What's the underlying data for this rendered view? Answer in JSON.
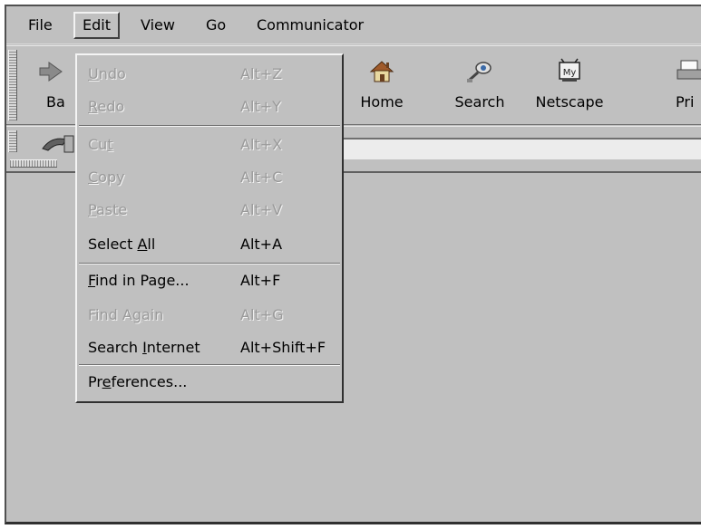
{
  "menubar": {
    "items": [
      {
        "label": "File"
      },
      {
        "label": "Edit"
      },
      {
        "label": "View"
      },
      {
        "label": "Go"
      },
      {
        "label": "Communicator"
      }
    ]
  },
  "toolbar": {
    "buttons": [
      {
        "label": "Ba",
        "icon": "back-arrow-icon"
      },
      {
        "label": "Home",
        "icon": "home-icon"
      },
      {
        "label": "Search",
        "icon": "search-icon"
      },
      {
        "label": "Netscape",
        "icon": "my-netscape-icon"
      },
      {
        "label": "Pri",
        "icon": "print-icon"
      }
    ]
  },
  "location_bar": {
    "icon": "bookmarks-icon",
    "url": ""
  },
  "edit_menu": {
    "items": [
      {
        "pre": "",
        "mn": "U",
        "post": "ndo",
        "shortcut": "Alt+Z",
        "enabled": false
      },
      {
        "pre": "",
        "mn": "R",
        "post": "edo",
        "shortcut": "Alt+Y",
        "enabled": false
      },
      {
        "pre": "Cu",
        "mn": "t",
        "post": "",
        "shortcut": "Alt+X",
        "enabled": false
      },
      {
        "pre": "",
        "mn": "C",
        "post": "opy",
        "shortcut": "Alt+C",
        "enabled": false
      },
      {
        "pre": "",
        "mn": "P",
        "post": "aste",
        "shortcut": "Alt+V",
        "enabled": false
      },
      {
        "pre": "Select ",
        "mn": "A",
        "post": "ll",
        "shortcut": "Alt+A",
        "enabled": true
      },
      {
        "pre": "",
        "mn": "F",
        "post": "ind in Page...",
        "shortcut": "Alt+F",
        "enabled": true
      },
      {
        "pre": "Find A",
        "mn": "g",
        "post": "ain",
        "shortcut": "Alt+G",
        "enabled": false
      },
      {
        "pre": "Search ",
        "mn": "I",
        "post": "nternet",
        "shortcut": "Alt+Shift+F",
        "enabled": true
      },
      {
        "pre": "Pr",
        "mn": "e",
        "post": "ferences...",
        "shortcut": "",
        "enabled": true
      }
    ]
  },
  "colors": {
    "chrome": "#c0c0c0",
    "disabled_text": "#9a9a9a",
    "highlight_edge": "#f4f4f4",
    "shadow_edge": "#303030"
  }
}
